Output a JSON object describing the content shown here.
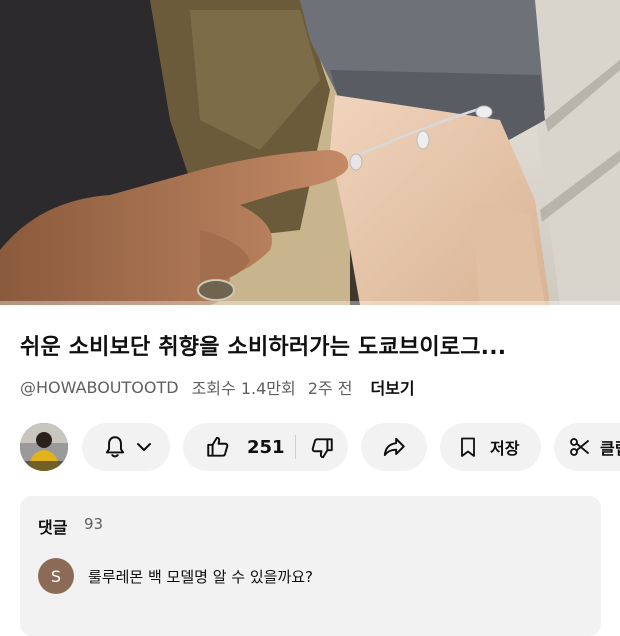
{
  "video": {
    "progress_fraction": 0.0,
    "progress_color": "#ff0033"
  },
  "info": {
    "title": "쉬운 소비보단 취향을 소비하러가는 도쿄브이로그...",
    "channel": "@HOWABOUTOOTD",
    "views": "조회수 1.4만회",
    "time_ago": "2주 전",
    "more_label": "더보기"
  },
  "actions": {
    "subscribe_icon": "bell-icon",
    "like_count": "251",
    "save_label": "저장",
    "clip_label": "클립"
  },
  "comments": {
    "header": "댓글",
    "count": "93",
    "first": {
      "avatar_letter": "S",
      "avatar_color": "#8b6b56",
      "text": "룰루레몬 백 모델명 알 수 있을까요?"
    }
  }
}
